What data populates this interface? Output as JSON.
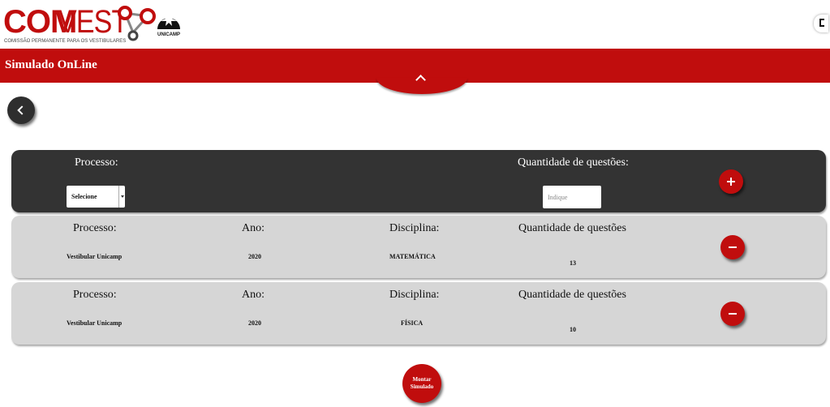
{
  "header": {
    "logo_com": "COM",
    "logo_vest": "VEST",
    "logo_subtitle": "COMISSÃO PERMANENTE PARA OS VESTIBULARES",
    "unicamp_label": "UNICAMP",
    "fullscreen_icon": "fullscreen-icon"
  },
  "bar": {
    "title": "Simulado OnLine",
    "collapse_icon": "chevron-up-icon"
  },
  "form": {
    "process_label": "Processo:",
    "qty_label": "Quantidade de questões:",
    "select_value": "Selecione",
    "qty_placeholder": "Indique",
    "add_icon": "plus-icon"
  },
  "rows": [
    {
      "process_label": "Processo:",
      "year_label": "Ano:",
      "discipline_label": "Disciplina:",
      "qty_label": "Quantidade de questões",
      "process": "Vestibular Unicamp",
      "year": "2020",
      "discipline": "MATEMÁTICA",
      "qty": "13"
    },
    {
      "process_label": "Processo:",
      "year_label": "Ano:",
      "discipline_label": "Disciplina:",
      "qty_label": "Quantidade de questões",
      "process": "Vestibular Unicamp",
      "year": "2020",
      "discipline": "FÍSICA",
      "qty": "10"
    }
  ],
  "submit": {
    "line1": "Montar",
    "line2": "Simulado"
  },
  "colors": {
    "brand_red": "#c00d0d",
    "dark_panel": "#333333",
    "row_panel": "#d6d6d6"
  }
}
